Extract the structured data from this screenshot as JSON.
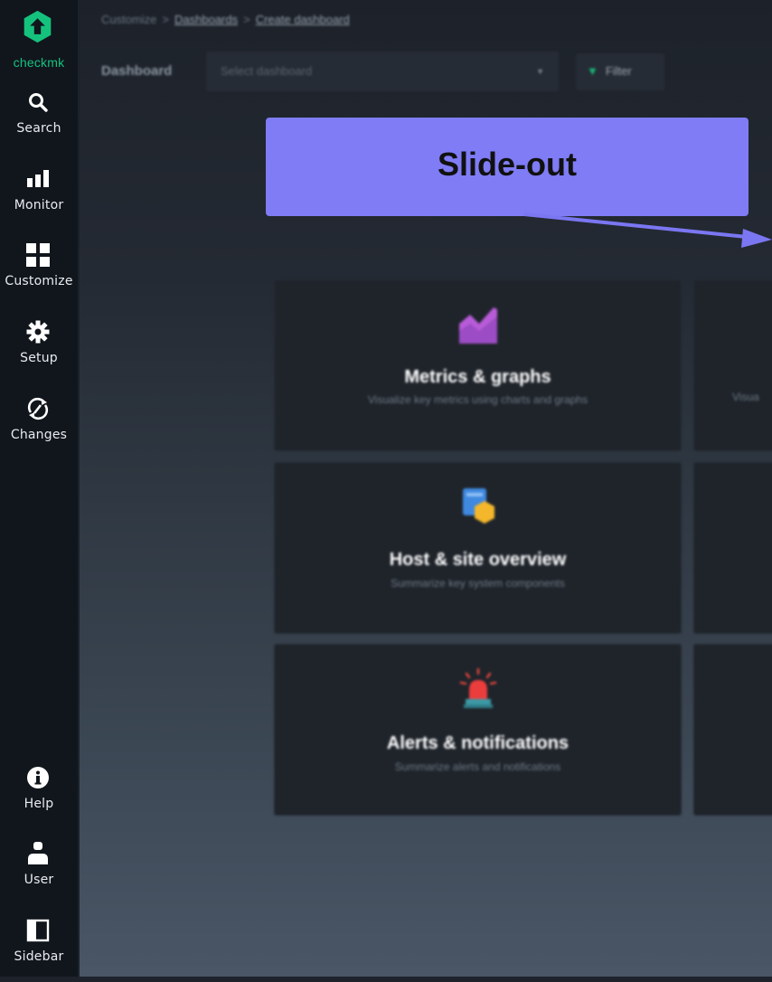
{
  "nav": {
    "logo_text": "checkmk",
    "items": [
      {
        "label": "Search",
        "icon": "search-icon"
      },
      {
        "label": "Monitor",
        "icon": "bar-chart-icon"
      },
      {
        "label": "Customize",
        "icon": "grid-icon"
      },
      {
        "label": "Setup",
        "icon": "gear-icon"
      },
      {
        "label": "Changes",
        "icon": "changes-icon"
      },
      {
        "label": "Help",
        "icon": "info-icon"
      },
      {
        "label": "User",
        "icon": "user-icon"
      },
      {
        "label": "Sidebar",
        "icon": "sidebar-panel-icon"
      }
    ]
  },
  "breadcrumb": {
    "root": "Customize",
    "separator": ">",
    "level1": "Dashboards",
    "level2": "Create dashboard"
  },
  "dashboard_select": {
    "label": "Dashboard",
    "placeholder": "Select dashboard"
  },
  "filter_button": {
    "label": "Filter"
  },
  "cards": [
    {
      "title": "Metrics & graphs",
      "description": "Visualize key metrics using charts and graphs",
      "icon": "area-chart-icon"
    },
    {
      "title": "Host & site overview",
      "description": "Summarize key system components",
      "icon": "host-site-icon"
    },
    {
      "title": "Alerts & notifications",
      "description": "Summarize alerts and notifications",
      "icon": "siren-icon"
    }
  ],
  "partial_card_fragment": "Visua",
  "callout": {
    "label": "Slide-out"
  },
  "colors": {
    "brand_green": "#15c27d",
    "callout": "#7f7cf6",
    "arrow": "#7b76f2"
  }
}
